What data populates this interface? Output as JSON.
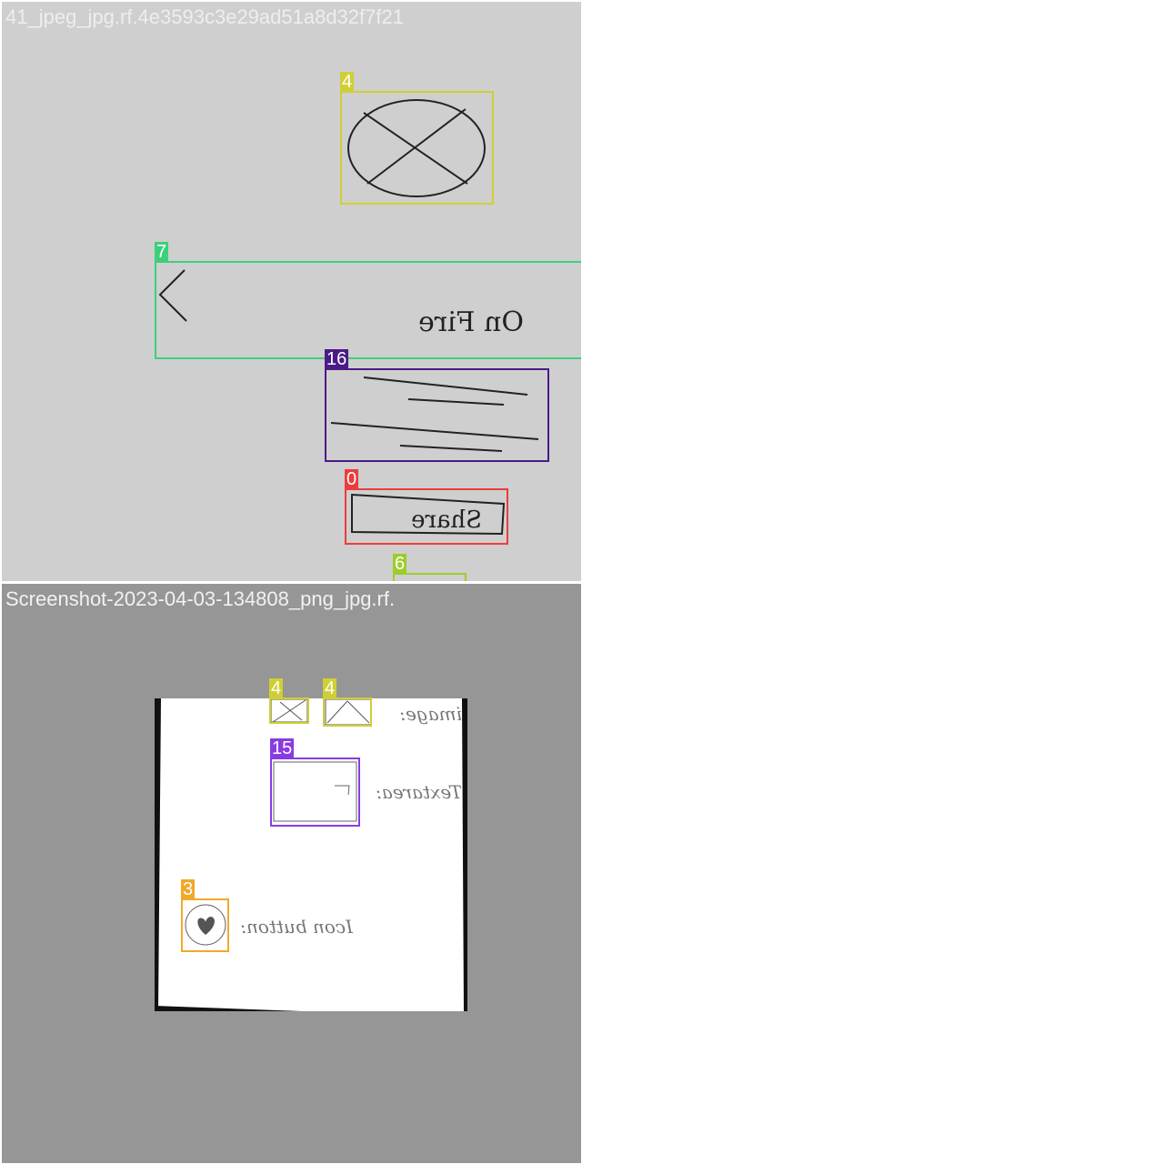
{
  "tiles": [
    {
      "title": "41_jpeg_jpg.rf.4e3593c3e29ad51a8d32f7f21",
      "background": "#cfcfcf",
      "annotations": [
        {
          "label": "4",
          "color": "#cfcf34"
        },
        {
          "label": "7",
          "color": "#3dd07c"
        },
        {
          "label": "16",
          "color": "#4b1a86"
        },
        {
          "label": "0",
          "color": "#ee3b3b"
        },
        {
          "label": "6",
          "color": "#9ccd2c"
        }
      ],
      "sketch_text": [
        "On Fire",
        "Share"
      ]
    },
    {
      "title": "Screenshot-2023-04-03-134808_png_jpg.rf.",
      "background": "#969696",
      "annotations": [
        {
          "label": "4",
          "color": "#cfcf34"
        },
        {
          "label": "4",
          "color": "#cfcf34"
        },
        {
          "label": "15",
          "color": "#8a3be0"
        },
        {
          "label": "3",
          "color": "#f1a92a"
        }
      ],
      "sketch_text": [
        "image:",
        "Textarea:",
        "Icon button:"
      ]
    }
  ]
}
